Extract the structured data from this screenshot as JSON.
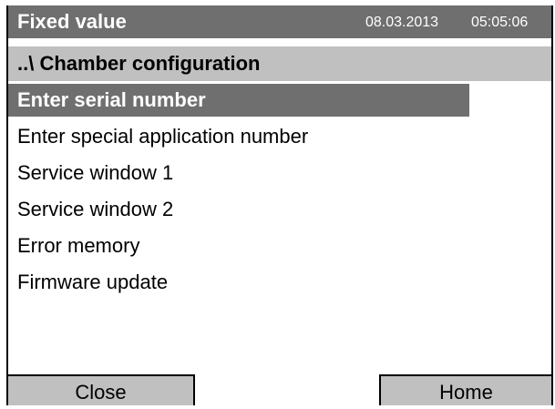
{
  "header": {
    "title": "Fixed value",
    "date": "08.03.2013",
    "time": "05:05:06"
  },
  "breadcrumb": "..\\ Chamber configuration",
  "menu": {
    "items": [
      {
        "label": "Enter serial number",
        "selected": true
      },
      {
        "label": "Enter special application number",
        "selected": false
      },
      {
        "label": "Service window 1",
        "selected": false
      },
      {
        "label": "Service window 2",
        "selected": false
      },
      {
        "label": "Error memory",
        "selected": false
      },
      {
        "label": "Firmware update",
        "selected": false
      }
    ]
  },
  "buttons": {
    "close_label": "Close",
    "home_label": "Home"
  },
  "colors": {
    "title_bar": "#6f6f6f",
    "breadcrumb_bar": "#c0c0c0",
    "selected_item": "#6f6f6f",
    "button": "#c0c0c0"
  }
}
